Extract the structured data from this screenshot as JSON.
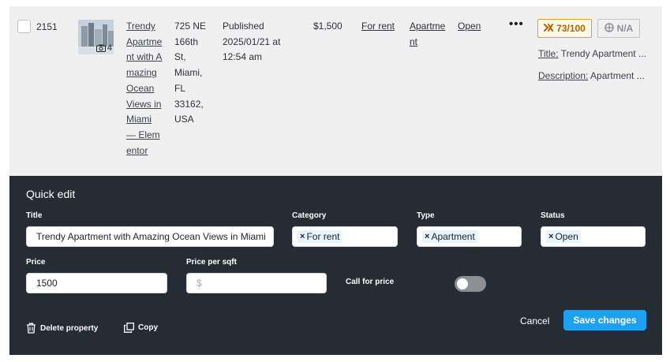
{
  "listing": {
    "id": "2151",
    "photo_count": "4",
    "title": "Trendy Apartment with Amazing Ocean Views in Miami — Elementor",
    "address": "725 NE 166th St, Miami, FL 33162, USA",
    "status_text": "Published 2025/01/21 at 12:54 am",
    "price": "$1,500",
    "category": "For rent",
    "type": "Apartment",
    "status": "Open",
    "more_label": "•••",
    "seo_score": "73/100",
    "readability": "N/A",
    "meta_title_key": "Title:",
    "meta_title_value": "Trendy Apartment ...",
    "meta_desc_key": "Description:",
    "meta_desc_value": "Apartment ..."
  },
  "quick_edit": {
    "heading": "Quick edit",
    "title_label": "Title",
    "title_value": "Trendy Apartment with Amazing Ocean Views in Miami",
    "category_label": "Category",
    "category_tag": "For rent",
    "type_label": "Type",
    "type_tag": "Apartment",
    "status_label": "Status",
    "status_tag": "Open",
    "tag_remove": "×",
    "price_label": "Price",
    "price_value": "1500",
    "ppsqft_label": "Price per sqft",
    "ppsqft_placeholder": "$",
    "call_for_price_label": "Call for price",
    "call_for_price_on": false,
    "delete_label": "Delete property",
    "copy_label": "Copy",
    "cancel_label": "Cancel",
    "save_label": "Save changes"
  },
  "colors": {
    "panel_bg": "#252c33",
    "row_bg": "#f0f0f1",
    "save_button": "#1ea1f2",
    "score_border": "#dba617",
    "score_text": "#b26200"
  },
  "icons": [
    "camera-icon",
    "seo-score-icon",
    "readability-icon",
    "trash-icon",
    "copy-icon"
  ]
}
